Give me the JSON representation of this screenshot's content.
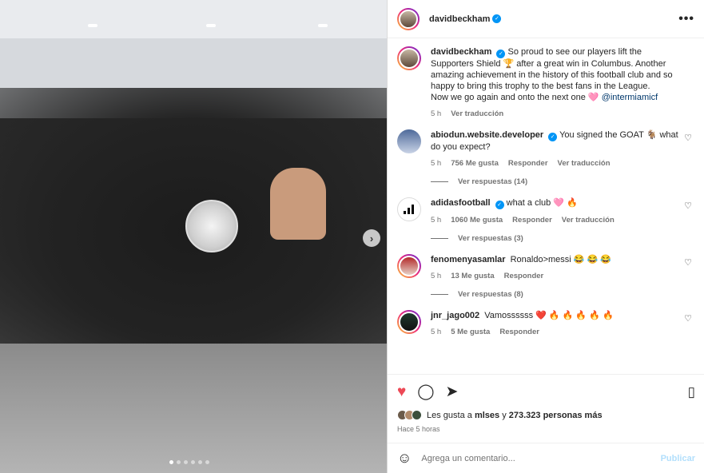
{
  "post": {
    "author": "davidbeckham",
    "caption_author": "davidbeckham",
    "caption_text": "So proud to see our players lift the Supporters Shield 🏆  after a great win in Columbus. Another amazing achievement in the history of this football club and so happy to bring this trophy to the best fans in the League.",
    "caption_text2": "Now we go again and onto the next one 🩷",
    "caption_mention": "@intermiamicf",
    "caption_time": "5 h",
    "caption_translate": "Ver traducción",
    "more_label": "•••"
  },
  "comments": [
    {
      "user": "abiodun.website.developer",
      "text": "You signed the GOAT 🐐 what do you expect?",
      "time": "5 h",
      "likes": "756 Me gusta",
      "reply": "Responder",
      "translate": "Ver traducción",
      "replies": "Ver respuestas (14)"
    },
    {
      "user": "adidasfootball",
      "text": "what a club 🩷 🔥",
      "time": "5 h",
      "likes": "1060 Me gusta",
      "reply": "Responder",
      "translate": "Ver traducción",
      "replies": "Ver respuestas (3)"
    },
    {
      "user": "fenomenyasamlar",
      "text": "Ronaldo>messi 😂 😂 😂",
      "time": "5 h",
      "likes": "13 Me gusta",
      "reply": "Responder",
      "replies": "Ver respuestas (8)"
    },
    {
      "user": "jnr_jago002",
      "text": "Vamossssss ❤️ 🔥 🔥 🔥 🔥 🔥",
      "time": "5 h",
      "likes": "5 Me gusta",
      "reply": "Responder"
    }
  ],
  "actions": {
    "likes_prefix": "Les gusta a",
    "likes_user": "mlses",
    "likes_mid": "y",
    "likes_count": "273.323 personas más",
    "posted_ago": "Hace 5 horas"
  },
  "composer": {
    "placeholder": "Agrega un comentario...",
    "publish_label": "Publicar"
  },
  "icons": {
    "heart": "♥",
    "heart_outline": "♡",
    "comment": "◯",
    "share": "➤",
    "save": "▯",
    "emoji": "☺",
    "arrow": "›"
  }
}
